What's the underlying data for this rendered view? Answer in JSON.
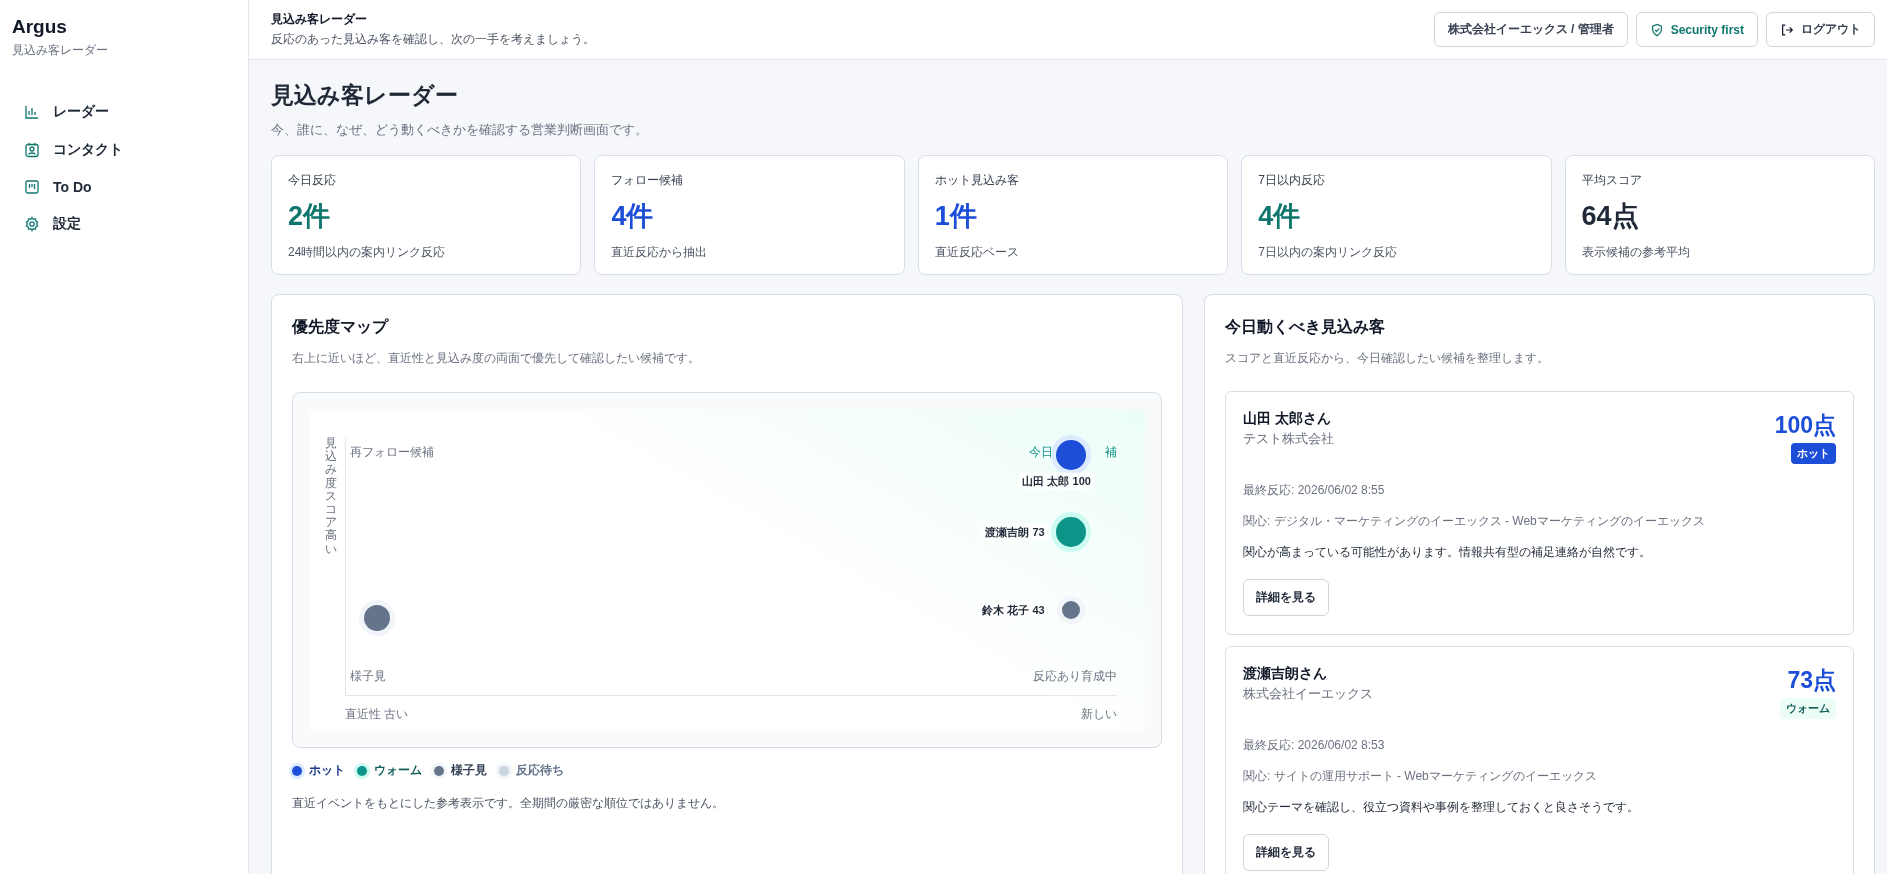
{
  "sidebar": {
    "brand": "Argus",
    "subtitle": "見込み客レーダー",
    "items": [
      {
        "label": "レーダー"
      },
      {
        "label": "コンタクト"
      },
      {
        "label": "To Do"
      },
      {
        "label": "設定"
      }
    ]
  },
  "header": {
    "title": "見込み客レーダー",
    "subtitle": "反応のあった見込み客を確認し、次の一手を考えましょう。",
    "account": "株式会社イーエックス / 管理者",
    "security": "Security first",
    "logout": "ログアウト"
  },
  "page": {
    "title": "見込み客レーダー",
    "subtitle": "今、誰に、なぜ、どう動くべきかを確認する営業判断画面です。"
  },
  "stats": [
    {
      "label": "今日反応",
      "value": "2件",
      "note": "24時間以内の案内リンク反応",
      "kind": "teal"
    },
    {
      "label": "フォロー候補",
      "value": "4件",
      "note": "直近反応から抽出",
      "kind": "blue"
    },
    {
      "label": "ホット見込み客",
      "value": "1件",
      "note": "直近反応ベース",
      "kind": "blue"
    },
    {
      "label": "7日以内反応",
      "value": "4件",
      "note": "7日以内の案内リンク反応",
      "kind": "teal"
    },
    {
      "label": "平均スコア",
      "value": "64点",
      "note": "表示候補の参考平均",
      "kind": "dark"
    }
  ],
  "map": {
    "title": "優先度マップ",
    "subtitle": "右上に近いほど、直近性と見込み度の両面で優先して確認したい候補です。",
    "y_axis": "見込み度スコア高い",
    "x_axis_left": "直近性 古い",
    "x_axis_right": "新しい",
    "quadrants": {
      "top_left": "再フォロー候補",
      "top_right": [
        "今日",
        "補"
      ],
      "bottom_left": "様子見",
      "bottom_right": "反応あり育成中"
    },
    "points": [
      {
        "label": "山田 太郎 100",
        "kind": "hot"
      },
      {
        "label": "渡瀬吉朗 73",
        "kind": "warm"
      },
      {
        "label": "鈴木 花子 43",
        "kind": "watch"
      },
      {
        "kind": "watch"
      }
    ],
    "legend": [
      {
        "label": "ホット",
        "kind": "hot"
      },
      {
        "label": "ウォーム",
        "kind": "warm"
      },
      {
        "label": "様子見",
        "kind": "watch"
      },
      {
        "label": "反応待ち",
        "kind": "waiting"
      }
    ],
    "note": "直近イベントをもとにした参考表示です。全期間の厳密な順位ではありません。"
  },
  "today": {
    "title": "今日動くべき見込み客",
    "subtitle": "スコアと直近反応から、今日確認したい候補を整理します。",
    "prospects": [
      {
        "name": "山田 太郎さん",
        "company": "テスト株式会社",
        "score": "100点",
        "badge": "ホット",
        "kind": "hot",
        "last": "最終反応: 2026/06/02 8:55",
        "interest": "関心: デジタル・マーケティングのイーエックス - Webマーケティングのイーエックス",
        "advice": "関心が高まっている可能性があります。情報共有型の補足連絡が自然です。",
        "button": "詳細を見る"
      },
      {
        "name": "渡瀬吉朗さん",
        "company": "株式会社イーエックス",
        "score": "73点",
        "badge": "ウォーム",
        "kind": "warm",
        "last": "最終反応: 2026/06/02 8:53",
        "interest": "関心: サイトの運用サポート - Webマーケティングのイーエックス",
        "advice": "関心テーマを確認し、役立つ資料や事例を整理しておくと良さそうです。",
        "button": "詳細を見る"
      }
    ]
  }
}
